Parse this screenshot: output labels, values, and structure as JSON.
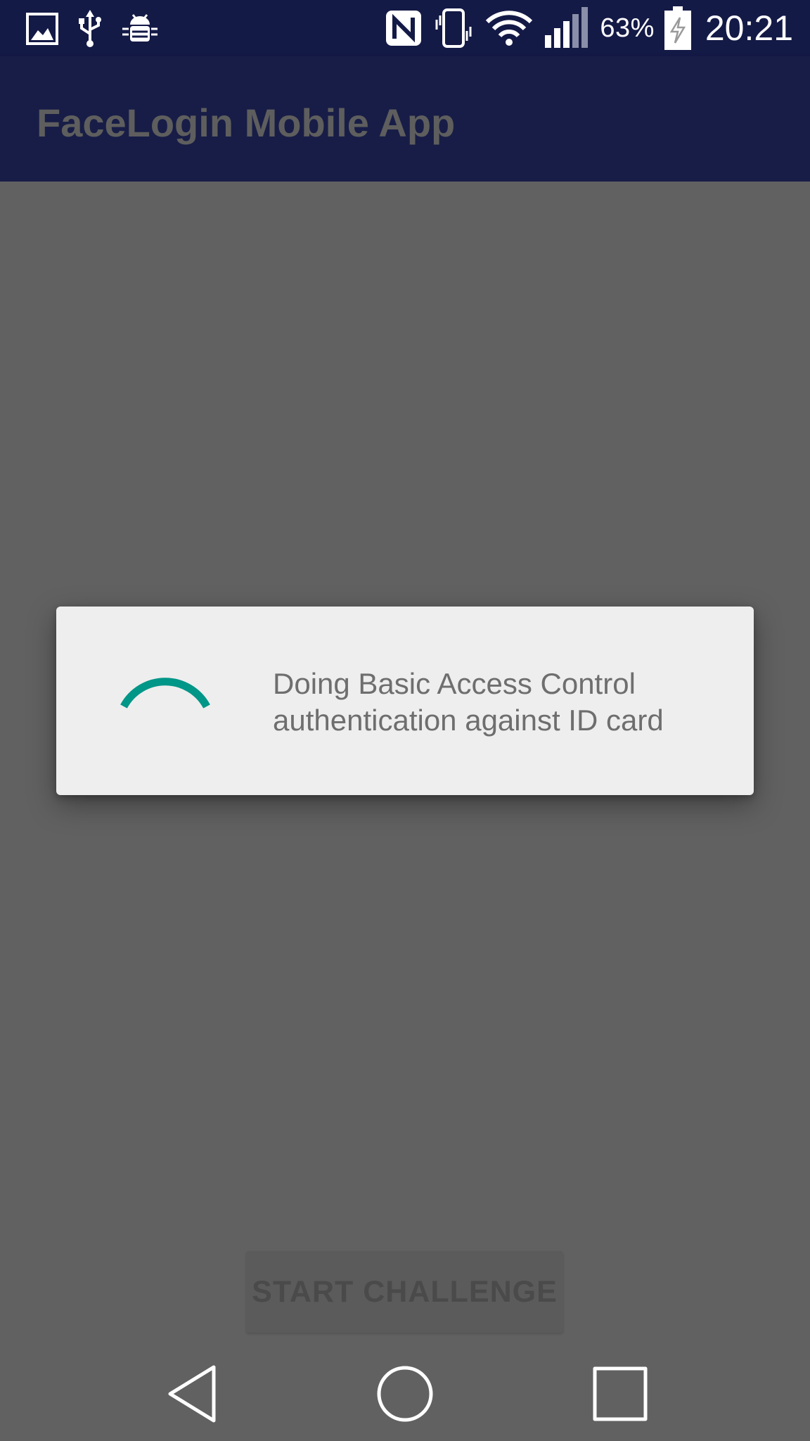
{
  "status_bar": {
    "left_icons": [
      "image-icon",
      "usb-icon",
      "android-debug-icon"
    ],
    "right_icons": [
      "nfc-icon",
      "vibrate-icon",
      "wifi-icon",
      "signal-icon"
    ],
    "battery_percent": "63%",
    "time": "20:21"
  },
  "app_bar": {
    "title": "FaceLogin Mobile App"
  },
  "dialog": {
    "message": "Doing Basic Access Control authentication against ID card",
    "spinner_color": "#009688"
  },
  "main": {
    "start_button_label": "START CHALLENGE"
  },
  "nav_bar": {
    "buttons": [
      "back-icon",
      "home-icon",
      "recents-icon"
    ]
  },
  "colors": {
    "status_bar": "#141a46",
    "app_bar": "#181d47",
    "scrim_background": "#616161",
    "dialog_background": "#eeeeee",
    "accent": "#009688"
  }
}
